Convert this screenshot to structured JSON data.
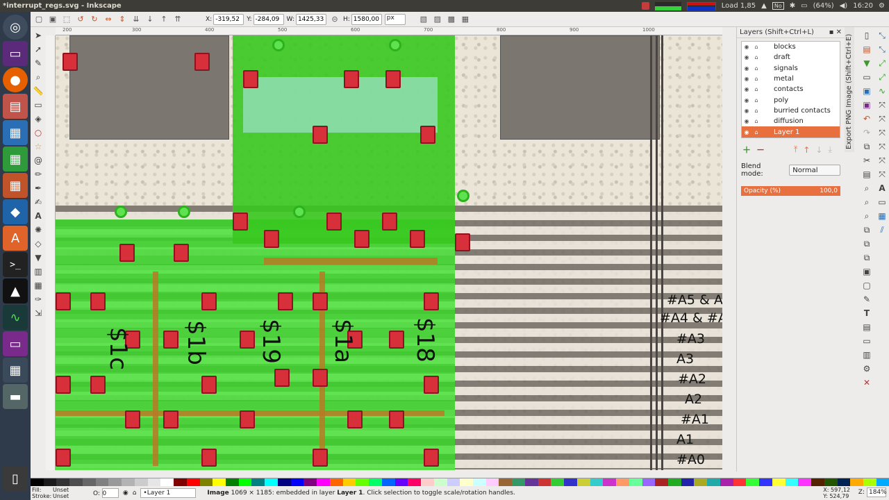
{
  "window": {
    "title": "*interrupt_regs.svg - Inkscape"
  },
  "tray": {
    "load": "Load 1,85",
    "keyboard": "No",
    "battery": "(64%)",
    "clock": "16:20"
  },
  "launcher": [
    {
      "icon": "ubuntu-dash-icon"
    },
    {
      "icon": "workspace-icon"
    },
    {
      "icon": "firefox-icon"
    },
    {
      "icon": "files-icon"
    },
    {
      "icon": "writer-icon"
    },
    {
      "icon": "calc-icon"
    },
    {
      "icon": "impress-icon"
    },
    {
      "icon": "virtualbox-icon"
    },
    {
      "icon": "software-center-icon"
    },
    {
      "icon": "terminal-icon"
    },
    {
      "icon": "inkscape-icon"
    },
    {
      "icon": "system-monitor-icon"
    },
    {
      "icon": "app-icon"
    },
    {
      "icon": "workspace-switcher-icon"
    },
    {
      "icon": "disk-icon"
    },
    {
      "icon": "trash-icon"
    }
  ],
  "toolbar": {
    "x_label": "X:",
    "x_value": "-319,52",
    "y_label": "Y:",
    "y_value": "-284,09",
    "w_label": "W:",
    "w_value": "1425,33",
    "h_label": "H:",
    "h_value": "1580,00",
    "unit": "px"
  },
  "ruler": {
    "ticks": [
      "200",
      "300",
      "400",
      "500",
      "600",
      "700",
      "800",
      "900",
      "1000"
    ]
  },
  "canvas": {
    "signal_labels": [
      "$1c",
      "$1b",
      "$19",
      "$1a",
      "$18"
    ],
    "address_labels": [
      "#A5 & A",
      "#A4 & #A",
      "#A3",
      "A3",
      "#A2",
      "A2",
      "#A1",
      "A1",
      "#A0",
      "A0"
    ]
  },
  "layers_panel": {
    "title": "Layers (Shift+Ctrl+L)",
    "layers": [
      "blocks",
      "draft",
      "signals",
      "metal",
      "contacts",
      "poly",
      "burried contacts",
      "diffusion",
      "Layer 1"
    ],
    "selected_layer": "Layer 1",
    "blend_label": "Blend mode:",
    "blend_value": "Normal",
    "opacity_label": "Opacity (%)",
    "opacity_value": "100,0"
  },
  "export_tab": {
    "label": "Export PNG Image (Shift+Ctrl+E)"
  },
  "status": {
    "fill_label": "Fill:",
    "fill_value": "Unset",
    "stroke_label": "Stroke:",
    "stroke_value": "Unset",
    "opacity_label": "O:",
    "opacity_value": "0",
    "layer": "•Layer 1",
    "message_bold": "Image",
    "message_rest": " 1069 × 1185: embedded in layer ",
    "message_layer": "Layer 1",
    "message_tail": ". Click selection to toggle scale/rotation handles.",
    "x": "X: 597,12",
    "y": "Y: 524,79",
    "zoom_label": "Z:",
    "zoom_value": "184%"
  },
  "colors": {
    "accent": "#e8703f",
    "diffusion": "#3fcf2e",
    "contact": "#d8303a",
    "poly": "#b97a24"
  },
  "palette": [
    "#000000",
    "#1a1a1a",
    "#333333",
    "#4d4d4d",
    "#666666",
    "#808080",
    "#999999",
    "#b3b3b3",
    "#cccccc",
    "#e6e6e6",
    "#ffffff",
    "#800000",
    "#ff0000",
    "#808000",
    "#ffff00",
    "#008000",
    "#00ff00",
    "#008080",
    "#00ffff",
    "#000080",
    "#0000ff",
    "#800080",
    "#ff00ff",
    "#ff6600",
    "#ffcc00",
    "#66ff00",
    "#00ff66",
    "#0066ff",
    "#6600ff",
    "#ff0066",
    "#ffcccc",
    "#ccffcc",
    "#ccccff",
    "#ffffcc",
    "#ccffff",
    "#ffccff",
    "#996633",
    "#339966",
    "#663399",
    "#cc3333",
    "#33cc33",
    "#3333cc",
    "#cccc33",
    "#33cccc",
    "#cc33cc",
    "#ff9966",
    "#66ff99",
    "#9966ff",
    "#aa2222",
    "#22aa22",
    "#2222aa",
    "#aaaa22",
    "#22aaaa",
    "#aa22aa",
    "#ff3333",
    "#33ff33",
    "#3333ff",
    "#ffff33",
    "#33ffff",
    "#ff33ff",
    "#552200",
    "#225500",
    "#002255",
    "#ffaa00",
    "#aaff00",
    "#00aaff"
  ]
}
